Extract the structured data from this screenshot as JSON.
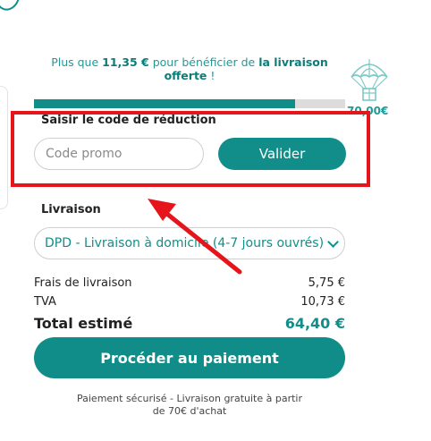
{
  "banner": {
    "prefix": "Plus que ",
    "amount": "11,35 €",
    "middle": " pour bénéficier de ",
    "emphasis": "la livraison offerte",
    "suffix": " !",
    "progress_fraction": 0.84
  },
  "threshold": "70,00€",
  "promo": {
    "title": "Saisir le code de réduction",
    "placeholder": "Code promo",
    "button_label": "Valider"
  },
  "shipping": {
    "title": "Livraison",
    "selected": "DPD - Livraison à domicile (4-7 jours ouvrés)"
  },
  "summary": {
    "rows": [
      {
        "label": "Frais de livraison",
        "value": "5,75 €"
      },
      {
        "label": "TVA",
        "value": "10,73 €"
      }
    ],
    "total_label": "Total estimé",
    "total_value": "64,40 €"
  },
  "checkout": {
    "button_label": "Procéder au paiement"
  },
  "footer": {
    "secure_note": "Paiement sécurisé - Livraison gratuite à partir de 70€ d'achat"
  },
  "colors": {
    "accent": "#128e8a",
    "highlight": "#e6151b"
  },
  "icons": {
    "gift": "gift-parachute-icon",
    "arrow": "red-annotation-arrow-icon",
    "chevron": "chevron-down-icon"
  }
}
